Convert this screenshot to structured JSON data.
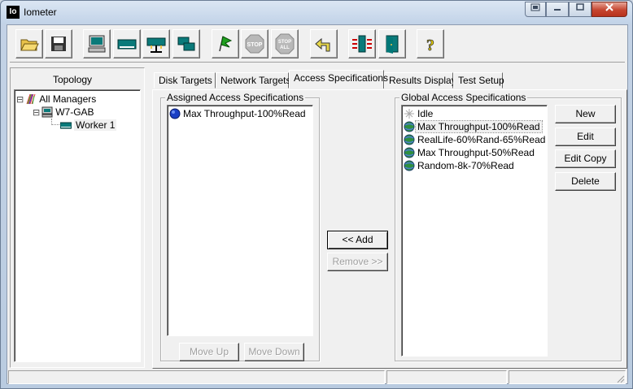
{
  "window": {
    "title": "Iometer",
    "app_icon": "Io"
  },
  "toolbar": {
    "stop_label": "STOP",
    "stop_all_label": "STOP ALL",
    "help_label": "?"
  },
  "topology": {
    "heading": "Topology",
    "tree": [
      {
        "label": "All Managers",
        "toggle": "⊟"
      },
      {
        "label": "W7-GAB",
        "toggle": "⊟"
      },
      {
        "label": "Worker 1"
      }
    ]
  },
  "tabs": [
    {
      "label": "Disk Targets"
    },
    {
      "label": "Network Targets"
    },
    {
      "label": "Access Specifications"
    },
    {
      "label": "Results Display"
    },
    {
      "label": "Test Setup"
    }
  ],
  "assigned": {
    "title": "Assigned Access Specifications",
    "items": [
      "Max Throughput-100%Read"
    ],
    "move_up": "Move Up",
    "move_down": "Move Down"
  },
  "middle": {
    "add": "<< Add",
    "remove": "Remove >>"
  },
  "global": {
    "title": "Global Access Specifications",
    "items": [
      "Idle",
      "Max Throughput-100%Read",
      "RealLife-60%Rand-65%Read",
      "Max Throughput-50%Read",
      "Random-8k-70%Read"
    ],
    "new": "New",
    "edit": "Edit",
    "edit_copy": "Edit Copy",
    "delete": "Delete"
  },
  "colors": {
    "close_button": "#c5452f",
    "titlebar": "#c2d3e8",
    "selected_outline": "#888888"
  }
}
